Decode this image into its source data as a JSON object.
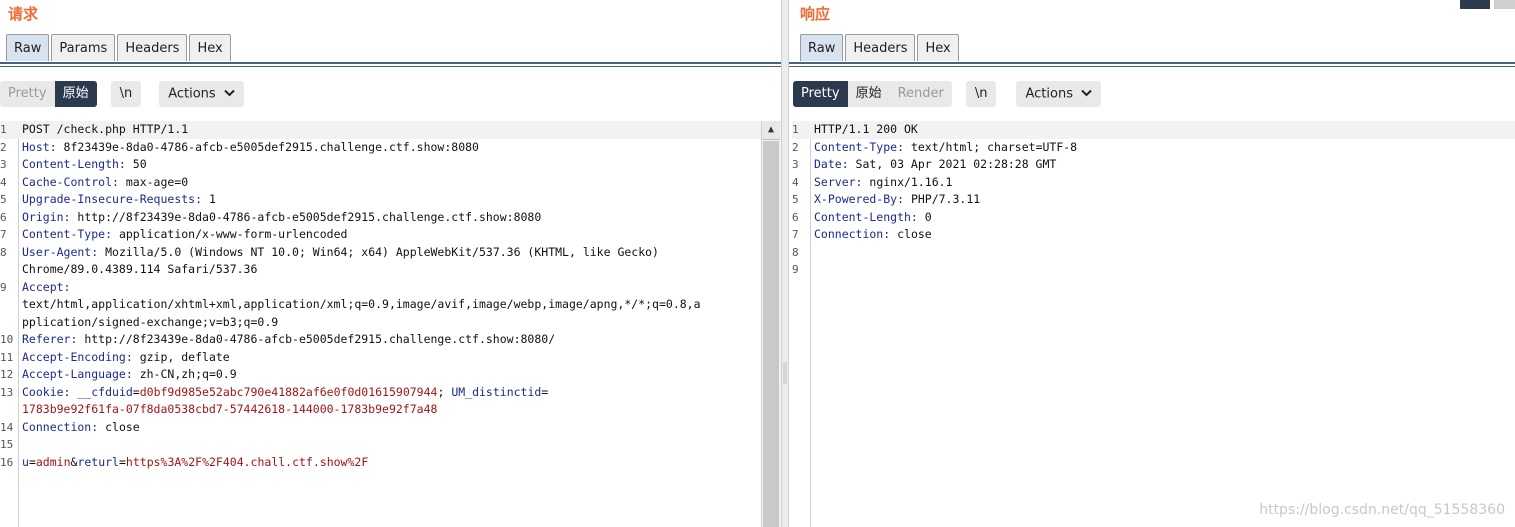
{
  "request": {
    "title": "请求",
    "tabs": [
      "Raw",
      "Params",
      "Headers",
      "Hex"
    ],
    "view_modes": [
      "Pretty",
      "原始"
    ],
    "newline_label": "\\n",
    "actions_label": "Actions",
    "lines": [
      {
        "n": "1",
        "parts": [
          {
            "t": "POST /check.php HTTP/1.1",
            "c": "v"
          }
        ]
      },
      {
        "n": "2",
        "parts": [
          {
            "t": "Host:",
            "c": "k"
          },
          {
            "t": " 8f23439e-8da0-4786-afcb-e5005def2915.challenge.ctf.show:8080",
            "c": "v"
          }
        ]
      },
      {
        "n": "3",
        "parts": [
          {
            "t": "Content-Length:",
            "c": "k"
          },
          {
            "t": " 50",
            "c": "v"
          }
        ]
      },
      {
        "n": "4",
        "parts": [
          {
            "t": "Cache-Control:",
            "c": "k"
          },
          {
            "t": " max-age=0",
            "c": "v"
          }
        ]
      },
      {
        "n": "5",
        "parts": [
          {
            "t": "Upgrade-Insecure-Requests:",
            "c": "k"
          },
          {
            "t": " 1",
            "c": "v"
          }
        ]
      },
      {
        "n": "6",
        "parts": [
          {
            "t": "Origin:",
            "c": "k"
          },
          {
            "t": " http://8f23439e-8da0-4786-afcb-e5005def2915.challenge.ctf.show:8080",
            "c": "v"
          }
        ]
      },
      {
        "n": "7",
        "parts": [
          {
            "t": "Content-Type:",
            "c": "k"
          },
          {
            "t": " application/x-www-form-urlencoded",
            "c": "v"
          }
        ]
      },
      {
        "n": "8",
        "parts": [
          {
            "t": "User-Agent:",
            "c": "k"
          },
          {
            "t": " Mozilla/5.0 (Windows NT 10.0; Win64; x64) AppleWebKit/537.36 (KHTML, like Gecko)",
            "c": "v"
          }
        ]
      },
      {
        "n": "",
        "parts": [
          {
            "t": "Chrome/89.0.4389.114 Safari/537.36",
            "c": "v"
          }
        ]
      },
      {
        "n": "9",
        "parts": [
          {
            "t": "Accept:",
            "c": "k"
          }
        ]
      },
      {
        "n": "",
        "parts": [
          {
            "t": "text/html,application/xhtml+xml,application/xml;q=0.9,image/avif,image/webp,image/apng,*/*;q=0.8,a",
            "c": "v"
          }
        ]
      },
      {
        "n": "",
        "parts": [
          {
            "t": "pplication/signed-exchange;v=b3;q=0.9",
            "c": "v"
          }
        ]
      },
      {
        "n": "10",
        "parts": [
          {
            "t": "Referer:",
            "c": "k"
          },
          {
            "t": " http://8f23439e-8da0-4786-afcb-e5005def2915.challenge.ctf.show:8080/",
            "c": "v"
          }
        ]
      },
      {
        "n": "11",
        "parts": [
          {
            "t": "Accept-Encoding:",
            "c": "k"
          },
          {
            "t": " gzip, deflate",
            "c": "v"
          }
        ]
      },
      {
        "n": "12",
        "parts": [
          {
            "t": "Accept-Language:",
            "c": "k"
          },
          {
            "t": " zh-CN,zh;q=0.9",
            "c": "v"
          }
        ]
      },
      {
        "n": "13",
        "parts": [
          {
            "t": "Cookie:",
            "c": "k"
          },
          {
            "t": " ",
            "c": "v"
          },
          {
            "t": "__cfduid",
            "c": "b"
          },
          {
            "t": "=",
            "c": "v"
          },
          {
            "t": "d0bf9d985e52abc790e41882af6e0f0d01615907944",
            "c": "r"
          },
          {
            "t": "; ",
            "c": "v"
          },
          {
            "t": "UM_distinctid",
            "c": "b"
          },
          {
            "t": "=",
            "c": "v"
          }
        ]
      },
      {
        "n": "",
        "parts": [
          {
            "t": "1783b9e92f61fa-07f8da0538cbd7-57442618-144000-1783b9e92f7a48",
            "c": "r"
          }
        ]
      },
      {
        "n": "14",
        "parts": [
          {
            "t": "Connection:",
            "c": "k"
          },
          {
            "t": " close",
            "c": "v"
          }
        ]
      },
      {
        "n": "15",
        "parts": []
      },
      {
        "n": "16",
        "parts": [
          {
            "t": "u",
            "c": "b"
          },
          {
            "t": "=",
            "c": "v"
          },
          {
            "t": "admin",
            "c": "r"
          },
          {
            "t": "&",
            "c": "v"
          },
          {
            "t": "returl",
            "c": "b"
          },
          {
            "t": "=",
            "c": "v"
          },
          {
            "t": "https%3A%2F%2F404.chall.ctf.show%2F",
            "c": "r"
          }
        ]
      }
    ]
  },
  "response": {
    "title": "响应",
    "tabs": [
      "Raw",
      "Headers",
      "Hex"
    ],
    "view_modes": [
      "Pretty",
      "原始",
      "Render"
    ],
    "newline_label": "\\n",
    "actions_label": "Actions",
    "lines": [
      {
        "n": "1",
        "parts": [
          {
            "t": "HTTP/1.1 200 OK",
            "c": "v"
          }
        ]
      },
      {
        "n": "2",
        "parts": [
          {
            "t": "Content-Type:",
            "c": "k"
          },
          {
            "t": " text/html; charset=UTF-8",
            "c": "v"
          }
        ]
      },
      {
        "n": "3",
        "parts": [
          {
            "t": "Date:",
            "c": "k"
          },
          {
            "t": " Sat, 03 Apr 2021 02:28:28 GMT",
            "c": "v"
          }
        ]
      },
      {
        "n": "4",
        "parts": [
          {
            "t": "Server:",
            "c": "k"
          },
          {
            "t": " nginx/1.16.1",
            "c": "v"
          }
        ]
      },
      {
        "n": "5",
        "parts": [
          {
            "t": "X-Powered-By:",
            "c": "k"
          },
          {
            "t": " PHP/7.3.11",
            "c": "v"
          }
        ]
      },
      {
        "n": "6",
        "parts": [
          {
            "t": "Content-Length:",
            "c": "k"
          },
          {
            "t": " 0",
            "c": "v"
          }
        ]
      },
      {
        "n": "7",
        "parts": [
          {
            "t": "Connection:",
            "c": "k"
          },
          {
            "t": " close",
            "c": "v"
          }
        ]
      },
      {
        "n": "8",
        "parts": []
      },
      {
        "n": "9",
        "parts": []
      }
    ]
  },
  "watermark": "https://blog.csdn.net/qq_51558360"
}
